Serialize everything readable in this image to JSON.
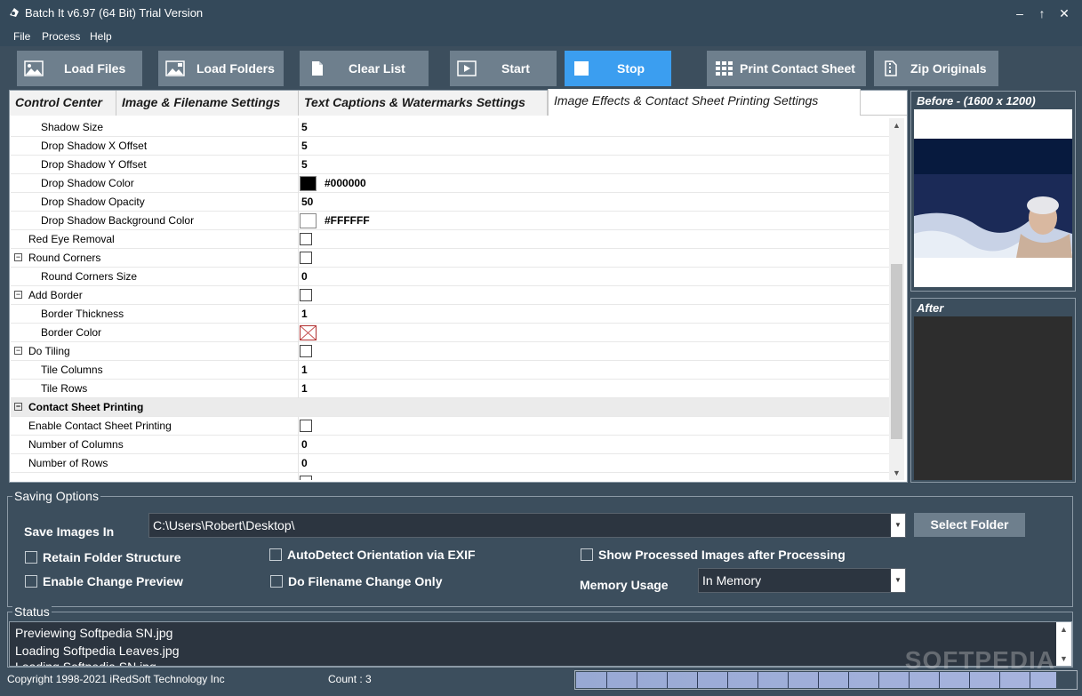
{
  "window": {
    "title": "Batch It v6.97 (64 Bit) Trial Version",
    "minimize": "–",
    "maximize": "↑",
    "close": "✕"
  },
  "menu": [
    "File",
    "Process",
    "Help"
  ],
  "toolbar": {
    "load_files": "Load Files",
    "load_folders": "Load Folders",
    "clear_list": "Clear List",
    "start": "Start",
    "stop": "Stop",
    "print_contact_sheet": "Print Contact Sheet",
    "zip_originals": "Zip Originals"
  },
  "tabs": [
    "Control Center",
    "Image & Filename Settings",
    "Text Captions & Watermarks Settings",
    "Image Effects & Contact Sheet Printing Settings"
  ],
  "properties": [
    {
      "label": "Shadow Size",
      "value": "5"
    },
    {
      "label": "Drop Shadow X Offset",
      "value": "5"
    },
    {
      "label": "Drop Shadow Y Offset",
      "value": "5"
    },
    {
      "label": "Drop Shadow Color",
      "color": "#000000",
      "hex": "#000000"
    },
    {
      "label": "Drop Shadow Opacity",
      "value": "50"
    },
    {
      "label": "Drop Shadow Background Color",
      "color": "#FFFFFF",
      "hex": "#FFFFFF"
    },
    {
      "label": "Red Eye Removal"
    },
    {
      "label": "Round Corners",
      "toggle": "⊟"
    },
    {
      "label": "Round Corners Size",
      "value": "0"
    },
    {
      "label": "Add Border",
      "toggle": "⊟"
    },
    {
      "label": "Border Thickness",
      "value": "1"
    },
    {
      "label": "Border Color"
    },
    {
      "label": "Do Tiling",
      "toggle": "⊟"
    },
    {
      "label": "Tile Columns",
      "value": "1"
    },
    {
      "label": "Tile Rows",
      "value": "1"
    },
    {
      "label": "Contact Sheet Printing",
      "toggle": "⊟"
    },
    {
      "label": "Enable Contact Sheet Printing"
    },
    {
      "label": "Number of Columns",
      "value": "0"
    },
    {
      "label": "Number of Rows",
      "value": "0"
    }
  ],
  "preview": {
    "before_title": "Before - (1600 x 1200)",
    "after_title": "After"
  },
  "saving": {
    "legend": "Saving Options",
    "save_images_in_label": "Save Images In",
    "path": "C:\\Users\\Robert\\Desktop\\",
    "select_folder": "Select Folder",
    "retain_folder_structure": "Retain Folder Structure",
    "enable_change_preview": "Enable Change Preview",
    "autodetect_orientation": "AutoDetect Orientation via EXIF",
    "do_filename_change_only": "Do Filename Change Only",
    "show_processed_images": "Show Processed Images after Processing",
    "memory_usage_label": "Memory Usage",
    "memory_usage_value": "In Memory"
  },
  "status": {
    "legend": "Status",
    "lines": [
      "Previewing Softpedia SN.jpg",
      "Loading Softpedia Leaves.jpg",
      "Loading Softpedia SN.jpg"
    ]
  },
  "footer": {
    "copyright": "Copyright 1998-2021 iRedSoft Technology Inc",
    "count": "Count : 3"
  },
  "progress_fraction": 0.96,
  "watermark": "SOFTPEDIA"
}
